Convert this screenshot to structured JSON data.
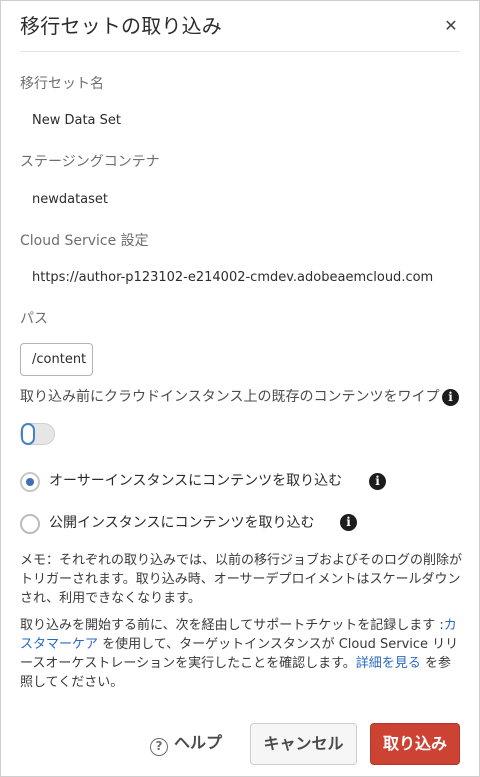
{
  "dialog": {
    "title": "移行セットの取り込み",
    "close_symbol": "✕"
  },
  "fields": {
    "migration_set_label": "移行セット名",
    "migration_set_value": "New Data Set",
    "staging_container_label": "ステージングコンテナ",
    "staging_container_value": "newdataset",
    "cloud_service_label": "Cloud Service 設定",
    "cloud_service_value": "https://author-p123102-e214002-cmdev.adobeaemcloud.com",
    "path_label": "パス",
    "path_value": "/content",
    "wipe_label": "取り込み前にクラウドインスタンス上の既存のコンテンツをワイプ",
    "wipe_checked": false
  },
  "radios": [
    {
      "label": "オーサーインスタンスにコンテンツを取り込む",
      "checked": true
    },
    {
      "label": "公開インスタンスにコンテンツを取り込む",
      "checked": false
    }
  ],
  "note1": "メモ：それぞれの取り込みでは、以前の移行ジョブおよびそのログの削除がトリガーされます。取り込み時、オーサーデプロイメントはスケールダウンされ、利用できなくなります。",
  "note2": {
    "part1": "取り込みを開始する前に、次を経由してサポートチケットを記録します :",
    "link1": "カスタマーケア",
    "part2": " を使用して、ターゲットインスタンスが Cloud Service リリースオーケストレーションを実行したことを確認します。",
    "link2": "詳細を見る",
    "part3": " を参照してください。"
  },
  "footer": {
    "help_glyph": "?",
    "help_label": "ヘルプ",
    "cancel_label": "キャンセル",
    "import_label": "取り込み"
  },
  "icons": {
    "info": "info-icon",
    "help": "help-icon",
    "close": "close-icon"
  },
  "colors": {
    "primary_button": "#cc4333",
    "link": "#2a68c2",
    "radio_selected": "#3f6fb6"
  }
}
